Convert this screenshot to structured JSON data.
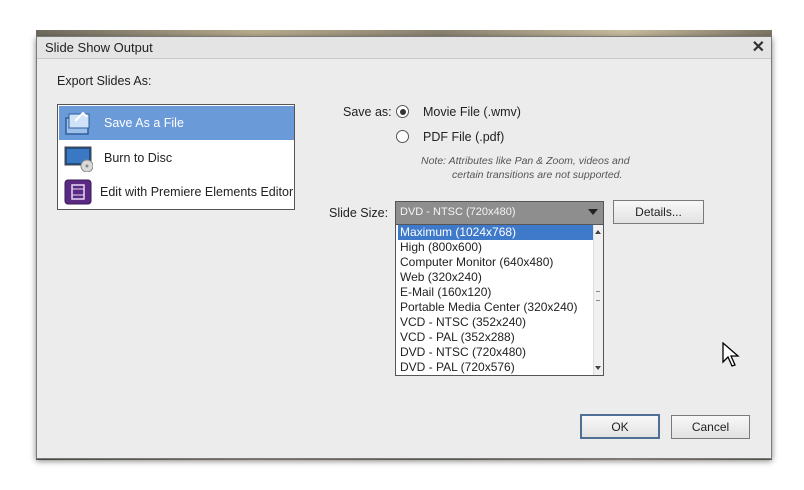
{
  "dialog": {
    "title": "Slide Show Output",
    "close_glyph": "✕",
    "export_label": "Export Slides As:",
    "export_items": [
      {
        "label": "Save As a File",
        "icon": "save-file-icon",
        "selected": true
      },
      {
        "label": "Burn to Disc",
        "icon": "disc-burn-icon",
        "selected": false
      },
      {
        "label": "Edit with Premiere Elements Editor",
        "icon": "premiere-film-icon",
        "selected": false
      }
    ],
    "save_as_label": "Save as:",
    "options": [
      {
        "label": "Movie File (.wmv)",
        "selected": true
      },
      {
        "label": "PDF File (.pdf)",
        "selected": false
      }
    ],
    "note_line1": "Note:  Attributes like Pan & Zoom, videos and",
    "note_line2": "certain transitions are not supported.",
    "slide_size_label": "Slide Size:",
    "slide_size_value": "DVD - NTSC (720x480)",
    "slide_size_options": [
      "Maximum (1024x768)",
      "High (800x600)",
      "Computer Monitor (640x480)",
      "Web (320x240)",
      "E-Mail (160x120)",
      "Portable Media Center (320x240)",
      "VCD - NTSC (352x240)",
      "VCD - PAL (352x288)",
      "DVD - NTSC (720x480)",
      "DVD - PAL (720x576)"
    ],
    "highlighted_option": "Maximum (1024x768)",
    "details_button": "Details...",
    "ok_button": "OK",
    "cancel_button": "Cancel"
  },
  "colors": {
    "selection_blue": "#6b9ad8",
    "dropdown_highlight": "#3f79c9",
    "dialog_bg": "#ececec"
  }
}
